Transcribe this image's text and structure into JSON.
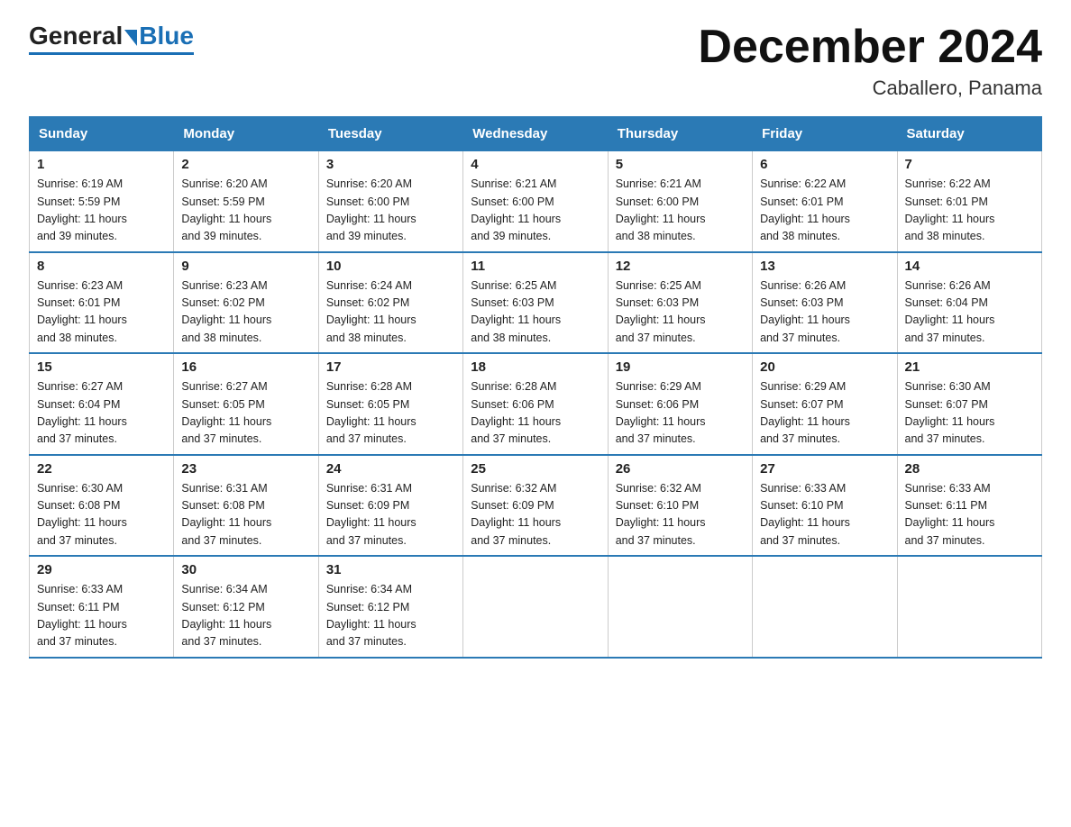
{
  "logo": {
    "general": "General",
    "blue": "Blue"
  },
  "header": {
    "title": "December 2024",
    "subtitle": "Caballero, Panama"
  },
  "weekdays": [
    "Sunday",
    "Monday",
    "Tuesday",
    "Wednesday",
    "Thursday",
    "Friday",
    "Saturday"
  ],
  "weeks": [
    [
      {
        "day": "1",
        "sunrise": "6:19 AM",
        "sunset": "5:59 PM",
        "daylight": "11 hours and 39 minutes."
      },
      {
        "day": "2",
        "sunrise": "6:20 AM",
        "sunset": "5:59 PM",
        "daylight": "11 hours and 39 minutes."
      },
      {
        "day": "3",
        "sunrise": "6:20 AM",
        "sunset": "6:00 PM",
        "daylight": "11 hours and 39 minutes."
      },
      {
        "day": "4",
        "sunrise": "6:21 AM",
        "sunset": "6:00 PM",
        "daylight": "11 hours and 39 minutes."
      },
      {
        "day": "5",
        "sunrise": "6:21 AM",
        "sunset": "6:00 PM",
        "daylight": "11 hours and 38 minutes."
      },
      {
        "day": "6",
        "sunrise": "6:22 AM",
        "sunset": "6:01 PM",
        "daylight": "11 hours and 38 minutes."
      },
      {
        "day": "7",
        "sunrise": "6:22 AM",
        "sunset": "6:01 PM",
        "daylight": "11 hours and 38 minutes."
      }
    ],
    [
      {
        "day": "8",
        "sunrise": "6:23 AM",
        "sunset": "6:01 PM",
        "daylight": "11 hours and 38 minutes."
      },
      {
        "day": "9",
        "sunrise": "6:23 AM",
        "sunset": "6:02 PM",
        "daylight": "11 hours and 38 minutes."
      },
      {
        "day": "10",
        "sunrise": "6:24 AM",
        "sunset": "6:02 PM",
        "daylight": "11 hours and 38 minutes."
      },
      {
        "day": "11",
        "sunrise": "6:25 AM",
        "sunset": "6:03 PM",
        "daylight": "11 hours and 38 minutes."
      },
      {
        "day": "12",
        "sunrise": "6:25 AM",
        "sunset": "6:03 PM",
        "daylight": "11 hours and 37 minutes."
      },
      {
        "day": "13",
        "sunrise": "6:26 AM",
        "sunset": "6:03 PM",
        "daylight": "11 hours and 37 minutes."
      },
      {
        "day": "14",
        "sunrise": "6:26 AM",
        "sunset": "6:04 PM",
        "daylight": "11 hours and 37 minutes."
      }
    ],
    [
      {
        "day": "15",
        "sunrise": "6:27 AM",
        "sunset": "6:04 PM",
        "daylight": "11 hours and 37 minutes."
      },
      {
        "day": "16",
        "sunrise": "6:27 AM",
        "sunset": "6:05 PM",
        "daylight": "11 hours and 37 minutes."
      },
      {
        "day": "17",
        "sunrise": "6:28 AM",
        "sunset": "6:05 PM",
        "daylight": "11 hours and 37 minutes."
      },
      {
        "day": "18",
        "sunrise": "6:28 AM",
        "sunset": "6:06 PM",
        "daylight": "11 hours and 37 minutes."
      },
      {
        "day": "19",
        "sunrise": "6:29 AM",
        "sunset": "6:06 PM",
        "daylight": "11 hours and 37 minutes."
      },
      {
        "day": "20",
        "sunrise": "6:29 AM",
        "sunset": "6:07 PM",
        "daylight": "11 hours and 37 minutes."
      },
      {
        "day": "21",
        "sunrise": "6:30 AM",
        "sunset": "6:07 PM",
        "daylight": "11 hours and 37 minutes."
      }
    ],
    [
      {
        "day": "22",
        "sunrise": "6:30 AM",
        "sunset": "6:08 PM",
        "daylight": "11 hours and 37 minutes."
      },
      {
        "day": "23",
        "sunrise": "6:31 AM",
        "sunset": "6:08 PM",
        "daylight": "11 hours and 37 minutes."
      },
      {
        "day": "24",
        "sunrise": "6:31 AM",
        "sunset": "6:09 PM",
        "daylight": "11 hours and 37 minutes."
      },
      {
        "day": "25",
        "sunrise": "6:32 AM",
        "sunset": "6:09 PM",
        "daylight": "11 hours and 37 minutes."
      },
      {
        "day": "26",
        "sunrise": "6:32 AM",
        "sunset": "6:10 PM",
        "daylight": "11 hours and 37 minutes."
      },
      {
        "day": "27",
        "sunrise": "6:33 AM",
        "sunset": "6:10 PM",
        "daylight": "11 hours and 37 minutes."
      },
      {
        "day": "28",
        "sunrise": "6:33 AM",
        "sunset": "6:11 PM",
        "daylight": "11 hours and 37 minutes."
      }
    ],
    [
      {
        "day": "29",
        "sunrise": "6:33 AM",
        "sunset": "6:11 PM",
        "daylight": "11 hours and 37 minutes."
      },
      {
        "day": "30",
        "sunrise": "6:34 AM",
        "sunset": "6:12 PM",
        "daylight": "11 hours and 37 minutes."
      },
      {
        "day": "31",
        "sunrise": "6:34 AM",
        "sunset": "6:12 PM",
        "daylight": "11 hours and 37 minutes."
      },
      null,
      null,
      null,
      null
    ]
  ]
}
